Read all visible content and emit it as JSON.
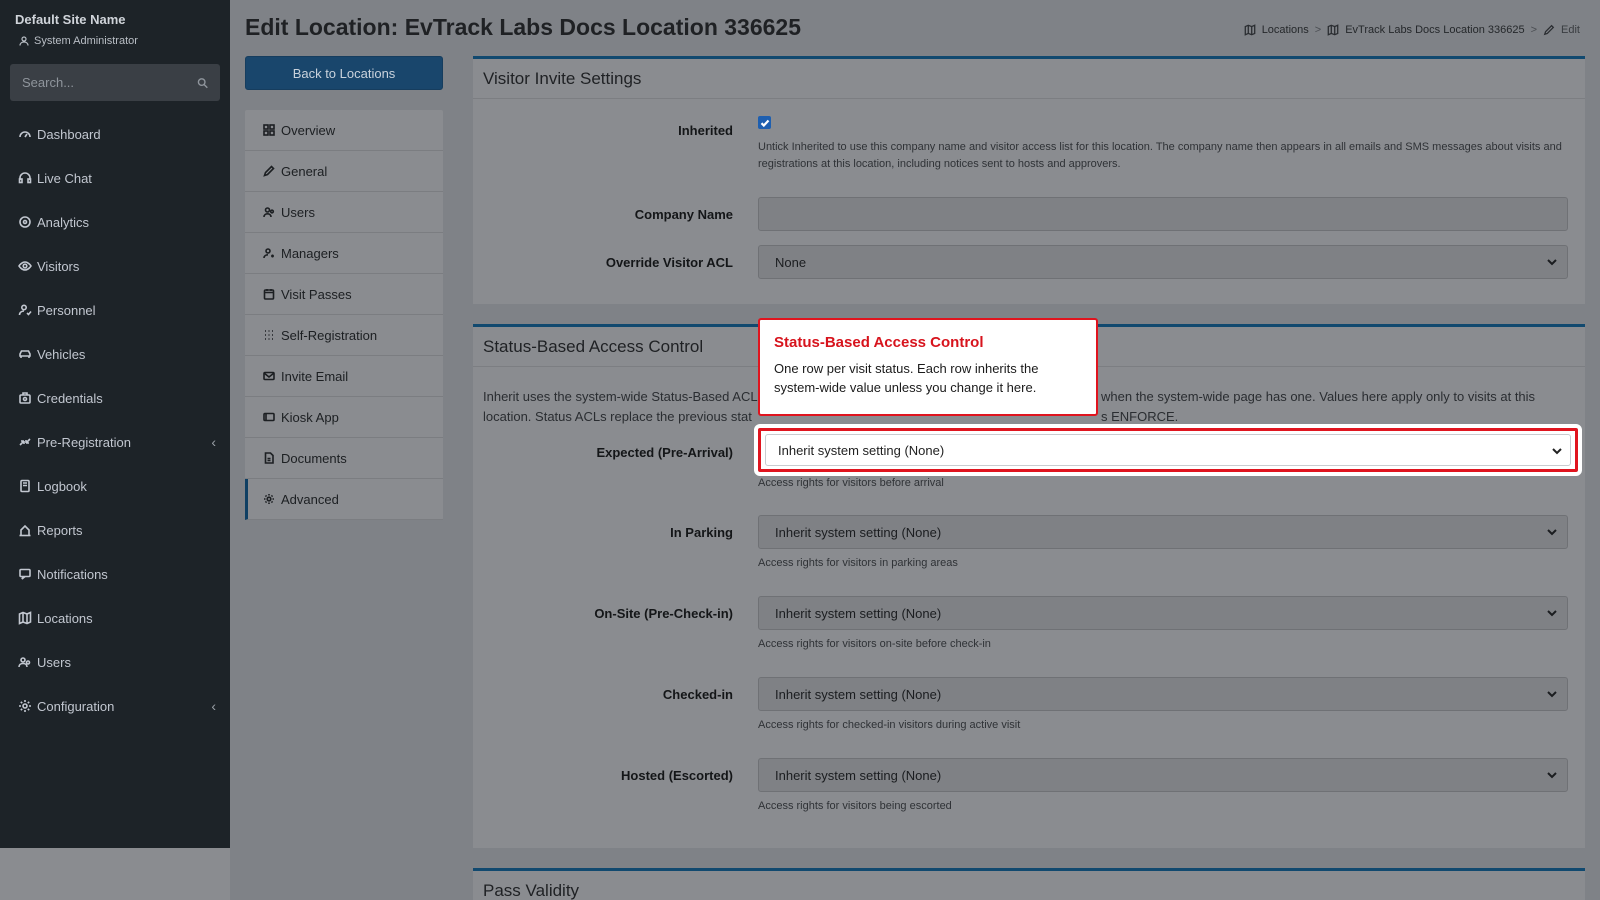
{
  "sidebar": {
    "site_name": "Default Site Name",
    "user_role": "System Administrator",
    "search_placeholder": "Search...",
    "items": [
      {
        "label": "Dashboard",
        "icon": "dashboard-icon"
      },
      {
        "label": "Live Chat",
        "icon": "headset-icon"
      },
      {
        "label": "Analytics",
        "icon": "analytics-icon"
      },
      {
        "label": "Visitors",
        "icon": "eye-icon"
      },
      {
        "label": "Personnel",
        "icon": "personnel-icon"
      },
      {
        "label": "Vehicles",
        "icon": "car-icon"
      },
      {
        "label": "Credentials",
        "icon": "badge-icon"
      },
      {
        "label": "Pre-Registration",
        "icon": "arrows-icon",
        "has_submenu": true
      },
      {
        "label": "Logbook",
        "icon": "book-icon"
      },
      {
        "label": "Reports",
        "icon": "reports-icon"
      },
      {
        "label": "Notifications",
        "icon": "bell-icon"
      },
      {
        "label": "Locations",
        "icon": "map-icon"
      },
      {
        "label": "Users",
        "icon": "users-icon"
      },
      {
        "label": "Configuration",
        "icon": "gear-icon",
        "has_submenu": true
      }
    ],
    "chevron": "‹"
  },
  "header": {
    "title": "Edit Location: EvTrack Labs Docs Location 336625",
    "breadcrumb": [
      "Locations",
      "EvTrack Labs Docs Location 336625",
      "Edit"
    ],
    "breadcrumb_sep": ">"
  },
  "back_button": "Back to Locations",
  "subnav": {
    "items": [
      "Overview",
      "General",
      "Users",
      "Managers",
      "Visit Passes",
      "Self-Registration",
      "Invite Email",
      "Kiosk App",
      "Documents",
      "Advanced"
    ],
    "active": "Advanced"
  },
  "visitor_invite": {
    "title": "Visitor Invite Settings",
    "inherited_label": "Inherited",
    "inherited_checked": true,
    "inherited_help": "Untick Inherited to use this company name and visitor access list for this location. The company name then appears in all emails and SMS messages about visits and registrations at this location, including notices sent to hosts and approvers.",
    "company_name_label": "Company Name",
    "company_name_value": "",
    "override_acl_label": "Override Visitor ACL",
    "override_acl_value": "None"
  },
  "status_acl": {
    "title": "Status-Based Access Control",
    "intro_line1_start": "Inherit uses the system-wide Status-Based ACL",
    "intro_line1_end": "when the system-wide page has one. Values here apply only to visits at this",
    "intro_line2_start": "location. Status ACLs replace the previous stat",
    "intro_line2_end": "s ENFORCE.",
    "rows": [
      {
        "label": "Expected (Pre-Arrival)",
        "value": "Inherit system setting (None)",
        "help": "Access rights for visitors before arrival"
      },
      {
        "label": "In Parking",
        "value": "Inherit system setting (None)",
        "help": "Access rights for visitors in parking areas"
      },
      {
        "label": "On-Site (Pre-Check-in)",
        "value": "Inherit system setting (None)",
        "help": "Access rights for visitors on-site before check-in"
      },
      {
        "label": "Checked-in",
        "value": "Inherit system setting (None)",
        "help": "Access rights for checked-in visitors during active visit"
      },
      {
        "label": "Hosted (Escorted)",
        "value": "Inherit system setting (None)",
        "help": "Access rights for visitors being escorted"
      }
    ]
  },
  "pass_validity": {
    "title": "Pass Validity"
  },
  "callout": {
    "title": "Status-Based Access Control",
    "body": "One row per visit status. Each row inherits the system-wide value unless you change it here."
  },
  "colors": {
    "sidebar_bg": "#1d2328",
    "accent": "#11496f",
    "highlight": "#e0141e"
  }
}
